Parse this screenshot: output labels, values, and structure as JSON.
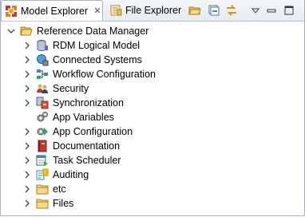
{
  "tabs": {
    "active": {
      "label": "Model Explorer",
      "close": "✕"
    },
    "inactive": {
      "label": "File Explorer"
    }
  },
  "toolbar": {
    "icons": [
      "open-folder-icon",
      "collapse-all-icon",
      "link-with-editor-icon",
      "view-menu-icon",
      "minimize-icon",
      "maximize-icon"
    ]
  },
  "tree": {
    "root": {
      "label": "Reference Data Manager",
      "icon": "open-folder-icon"
    },
    "items": [
      {
        "label": "RDM Logical Model",
        "icon": "database-icon",
        "expandable": true
      },
      {
        "label": "Connected Systems",
        "icon": "globe-icon",
        "expandable": true
      },
      {
        "label": "Workflow Configuration",
        "icon": "workflow-icon",
        "expandable": true
      },
      {
        "label": "Security",
        "icon": "users-icon",
        "expandable": true
      },
      {
        "label": "Synchronization",
        "icon": "sync-icon",
        "expandable": true
      },
      {
        "label": "App Variables",
        "icon": "gears-icon",
        "expandable": false
      },
      {
        "label": "App Configuration",
        "icon": "app-config-icon",
        "expandable": true
      },
      {
        "label": "Documentation",
        "icon": "book-icon",
        "expandable": true
      },
      {
        "label": "Task Scheduler",
        "icon": "scheduler-icon",
        "expandable": true
      },
      {
        "label": "Auditing",
        "icon": "auditing-icon",
        "expandable": true
      },
      {
        "label": "etc",
        "icon": "folder-icon",
        "expandable": true
      },
      {
        "label": "Files",
        "icon": "folder-icon",
        "expandable": true
      }
    ]
  },
  "colors": {
    "folder": "#e7c35a",
    "accent": "#3a7bd5"
  }
}
